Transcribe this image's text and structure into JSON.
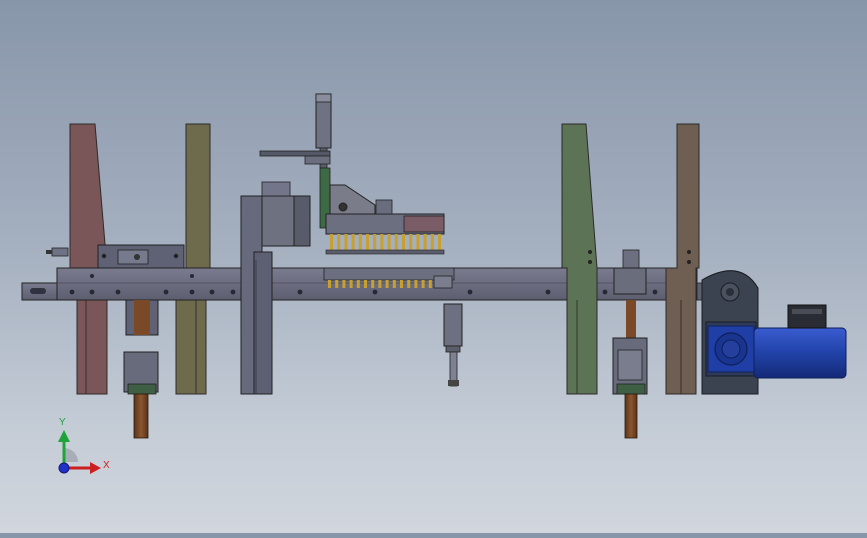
{
  "viewport": {
    "model": "conveyor-positioning-assembly",
    "view": "front"
  },
  "triad": {
    "y_label": "Y",
    "x_label": "X",
    "colors": {
      "y": "#1fa33a",
      "x": "#cc1f1f",
      "z": "#2230c8"
    }
  },
  "colors": {
    "background_top": "#8896aa",
    "background_bottom": "#d1d6dd",
    "beam": "#6d6e80",
    "plate_red": "#7a5658",
    "plate_olive": "#6e6b4d",
    "plate_green": "#5c7356",
    "plate_brown": "#6f5e52",
    "shaft_copper": "#7a4a28",
    "motor_blue": "#1f3fa6",
    "gearbox": "#3b4350"
  },
  "icons": {
    "triad": "coordinate-triad-icon",
    "motor": "motor-icon"
  }
}
